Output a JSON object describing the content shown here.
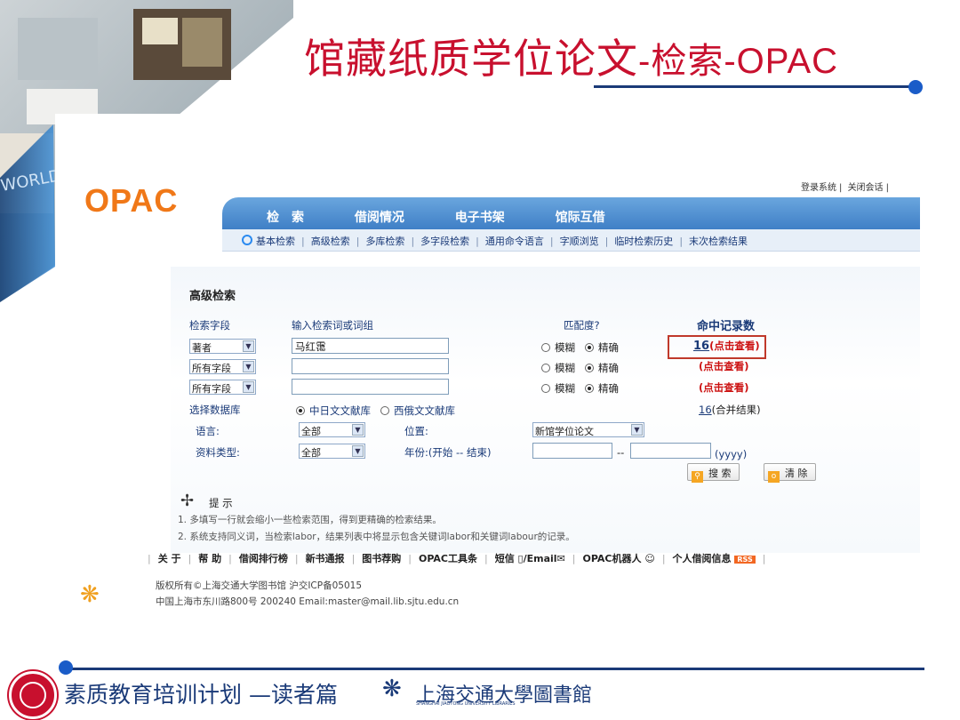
{
  "slide_title": {
    "cn": "馆藏纸质学位论文",
    "sep1": "-",
    "search": "检索",
    "sep2": "-",
    "en": "OPAC"
  },
  "opac_logo": "OPAC",
  "top_links": [
    "登录系统",
    "关闭会话"
  ],
  "nav_main": [
    "检　索",
    "借阅情况",
    "电子书架",
    "馆际互借"
  ],
  "subnav": [
    "基本检索",
    "高级检索",
    "多库检索",
    "多字段检索",
    "通用命令语言",
    "字顺浏览",
    "临时检索历史",
    "末次检索结果"
  ],
  "form": {
    "title": "高级检索",
    "col_field": "检索字段",
    "col_term": "输入检索词或词组",
    "col_match": "匹配度?",
    "col_hits": "命中记录数",
    "rows": [
      {
        "field": "著者",
        "value": "马红霭",
        "fuzzy": "模糊",
        "exact": "精确",
        "hits_num": "16",
        "hits_link": "(点击查看)"
      },
      {
        "field": "所有字段",
        "value": "",
        "fuzzy": "模糊",
        "exact": "精确",
        "hits_num": "",
        "hits_link": "(点击查看)"
      },
      {
        "field": "所有字段",
        "value": "",
        "fuzzy": "模糊",
        "exact": "精确",
        "hits_num": "",
        "hits_link": "(点击查看)"
      }
    ],
    "db_label": "选择数据库",
    "db_cn": "中日文文献库",
    "db_west": "西俄文文献库",
    "merged_num": "16",
    "merged_text": "(合并结果)",
    "lang_label": "语言:",
    "lang_value": "全部",
    "location_label": "位置:",
    "location_value": "新馆学位论文",
    "type_label": "资料类型:",
    "type_value": "全部",
    "year_label": "年份:(开始 -- 结束)",
    "year_sep": "--",
    "year_hint": "(yyyy)",
    "search_btn": "搜 索",
    "clear_btn": "清 除"
  },
  "tips": {
    "title": "提 示",
    "line1": "1. 多填写一行就会缩小一些检索范围，得到更精确的检索结果。",
    "line2": "2. 系统支持同义词，当检索labor，结果列表中将显示包含关键词labor和关键词labour的记录。"
  },
  "footer_links": [
    "关 于",
    "帮 助",
    "借阅排行榜",
    "新书通报",
    "图书荐购",
    "OPAC工具条",
    "短信",
    "/Email",
    "OPAC机器人",
    "个人借阅信息"
  ],
  "rss": "RSS",
  "copyright": {
    "line1": "版权所有©上海交通大学图书馆  沪交ICP备05015",
    "line2": "中国上海市东川路800号 200240  Email:master@mail.lib.sjtu.edu.cn"
  },
  "bottom": {
    "program": "素质教育培训计划",
    "dash": "—",
    "section": "读者篇",
    "library_cn": "上海交通大學圖書館",
    "library_en": "SHANGHAI JIAOTONG UNIVERSITY LIBRARIES"
  },
  "colors": {
    "title_red": "#c8102e",
    "navy": "#1a3a78",
    "opac_orange": "#f07818",
    "nav_blue": "#4a8ad0",
    "hit_red": "#cc1111"
  }
}
